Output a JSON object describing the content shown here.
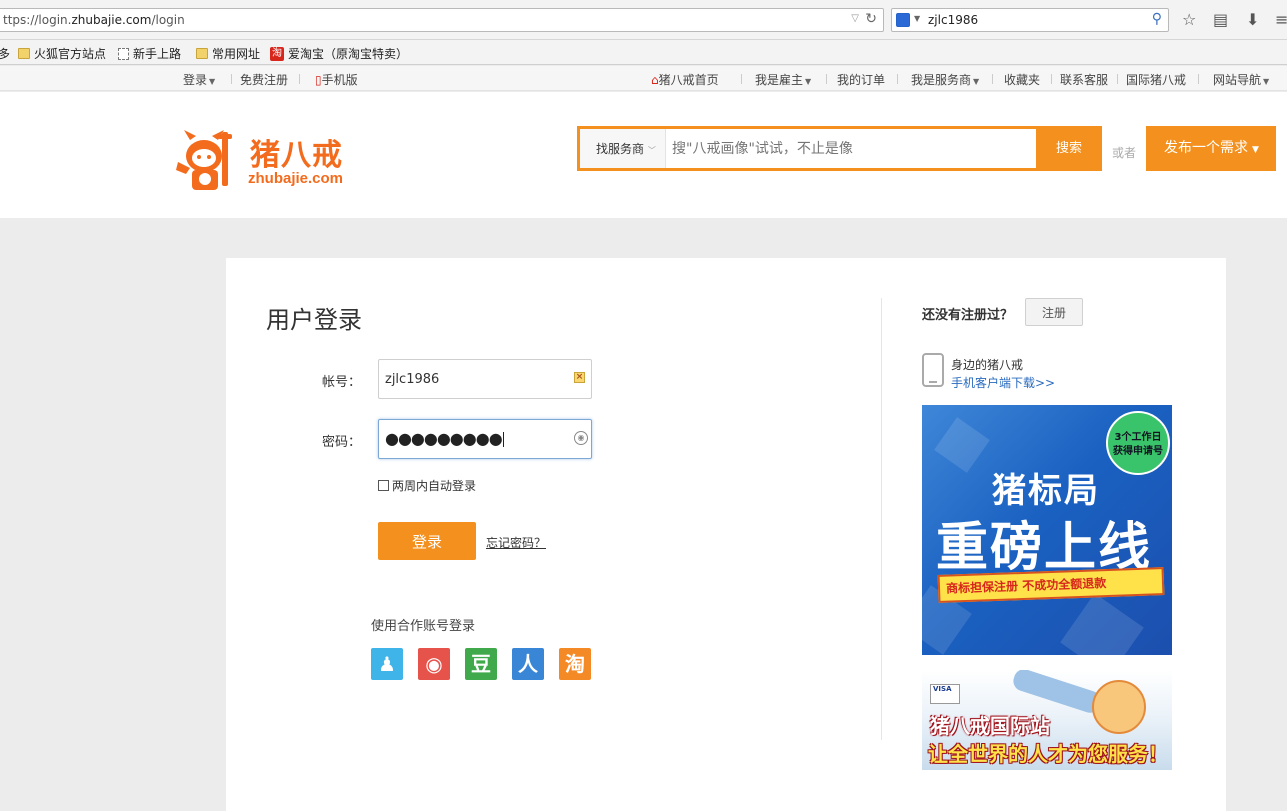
{
  "browser": {
    "url_prefix": "ttps://login.",
    "url_host": "zhubajie.com",
    "url_path": "/login",
    "search_value": "zjlc1986"
  },
  "bookmarks": {
    "cut_item": "多",
    "items": [
      "火狐官方站点",
      "新手上路",
      "常用网址",
      "爱淘宝（原淘宝特卖）"
    ],
    "tao_glyph": "淘"
  },
  "topnav": {
    "login": "登录",
    "register": "免费注册",
    "mobile": "手机版",
    "home": "猪八戒首页",
    "employer": "我是雇主",
    "orders": "我的订单",
    "provider": "我是服务商",
    "favorites": "收藏夹",
    "service": "联系客服",
    "intl": "国际猪八戒",
    "sitenav": "网站导航",
    "caret": "▼"
  },
  "header": {
    "logo_text": "猪八戒",
    "logo_sub": "zhubajie.com",
    "search_type": "找服务商",
    "search_placeholder": "搜\"八戒画像\"试试，不止是像",
    "search_button": "搜索",
    "or_text": "或者",
    "publish_button": "发布一个需求"
  },
  "login": {
    "title": "用户登录",
    "account_label": "帐号：",
    "account_value": "zjlc1986",
    "password_label": "密码：",
    "password_mask": "●●●●●●●●●",
    "remember": "两周内自动登录",
    "submit": "登录",
    "forgot": "忘记密码？",
    "partner_label": "使用合作账号登录",
    "partners": [
      {
        "name": "QQ",
        "glyph": "♟",
        "color": "#3fb4e8"
      },
      {
        "name": "微博",
        "glyph": "◉",
        "color": "#e5534b"
      },
      {
        "name": "豆瓣",
        "glyph": "豆",
        "color": "#3fa94b"
      },
      {
        "name": "人人",
        "glyph": "人",
        "color": "#3a86d6"
      },
      {
        "name": "淘宝",
        "glyph": "淘",
        "color": "#f48a26"
      }
    ]
  },
  "sidebar": {
    "no_account": "还没有注册过？",
    "register_button": "注册",
    "mobile_title": "身边的猪八戒",
    "mobile_link": "手机客户端下载>>"
  },
  "ads": {
    "ad1_badge_line1": "3个工作日",
    "ad1_badge_line2": "获得申请号",
    "ad1_title": "猪标局",
    "ad1_headline": "重磅上线",
    "ad1_strip_a": "商标担保注册",
    "ad1_strip_b": "不成功全额退款",
    "ad2_card": "VISA",
    "ad2_line1": "猪八戒国际站",
    "ad2_line2": "让全世界的人才为您服务！"
  },
  "colors": {
    "brand_orange": "#f4911e",
    "link_blue": "#2a6bbf"
  }
}
